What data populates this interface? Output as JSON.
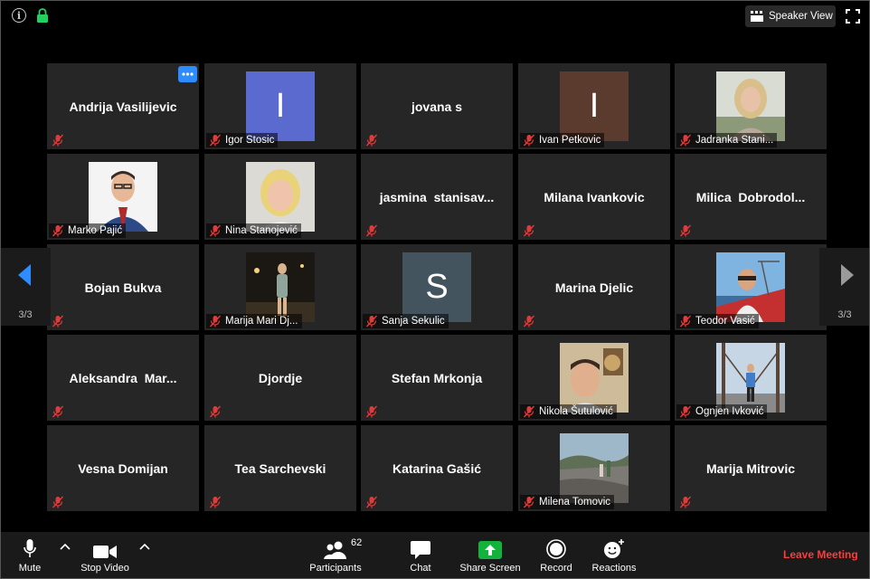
{
  "top": {
    "speaker_view_label": "Speaker View"
  },
  "pagination": {
    "left": "3/3",
    "right": "3/3"
  },
  "participants": [
    {
      "label": "Andrija Vasilijevic",
      "display": "name",
      "more_menu": true
    },
    {
      "label": "Igor Stosic",
      "display": "initial",
      "initial": "I",
      "avatar_color": "#5b6acf"
    },
    {
      "label": "jovana s",
      "display": "name"
    },
    {
      "label": "Ivan Petkovic",
      "display": "initial",
      "initial": "I",
      "avatar_color": "#5c3b2f"
    },
    {
      "label": "Jadranka Stani...",
      "display": "photo",
      "photo": "woman-blonde"
    },
    {
      "label": "Marko Pajić",
      "display": "photo",
      "photo": "man-suit"
    },
    {
      "label": "Nina Stanojević",
      "display": "photo",
      "photo": "woman-selfie"
    },
    {
      "label": "jasmina  stanisav...",
      "display": "name"
    },
    {
      "label": "Milana Ivankovic",
      "display": "name"
    },
    {
      "label": "Milica  Dobrodol...",
      "display": "name"
    },
    {
      "label": "Bojan Bukva",
      "display": "name"
    },
    {
      "label": "Marija Mari Dj...",
      "display": "photo",
      "photo": "night-street"
    },
    {
      "label": "Sanja Sekulic",
      "display": "initial",
      "initial": "S",
      "avatar_color": "#44545f"
    },
    {
      "label": "Marina Djelic",
      "display": "name"
    },
    {
      "label": "Teodor Vasić",
      "display": "photo",
      "photo": "man-boat"
    },
    {
      "label": "Aleksandra  Mar...",
      "display": "name"
    },
    {
      "label": "Djordje",
      "display": "name"
    },
    {
      "label": "Stefan Mrkonja",
      "display": "name"
    },
    {
      "label": "Nikola Šutulović",
      "display": "photo",
      "photo": "man-indoor"
    },
    {
      "label": "Ognjen Ivković",
      "display": "photo",
      "photo": "bridge"
    },
    {
      "label": "Vesna Domijan",
      "display": "name"
    },
    {
      "label": "Tea Sarchevski",
      "display": "name"
    },
    {
      "label": "Katarina Gašić",
      "display": "name"
    },
    {
      "label": "Milena Tomovic",
      "display": "photo",
      "photo": "rocks-outdoor"
    },
    {
      "label": "Marija Mitrovic",
      "display": "name"
    }
  ],
  "toolbar": {
    "mute_label": "Mute",
    "video_label": "Stop Video",
    "participants_label": "Participants",
    "participants_count": "62",
    "chat_label": "Chat",
    "share_label": "Share Screen",
    "record_label": "Record",
    "reactions_label": "Reactions",
    "leave_label": "Leave Meeting"
  },
  "colors": {
    "accent": "#2d8cff",
    "share": "#12b23c",
    "leave": "#ff3b3b",
    "muted": "#e03a3a",
    "tile": "#262626"
  }
}
